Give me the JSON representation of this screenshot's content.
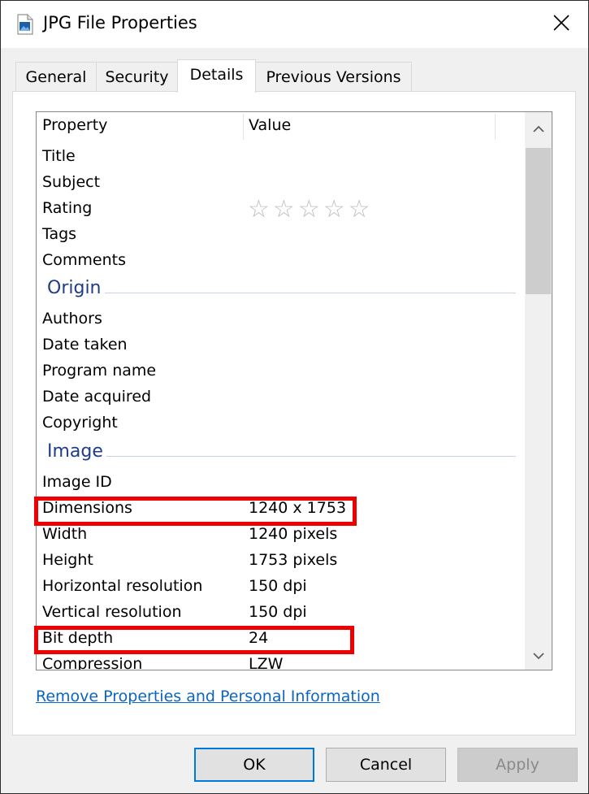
{
  "window": {
    "title": "JPG File Properties"
  },
  "tabs": [
    {
      "label": "General"
    },
    {
      "label": "Security"
    },
    {
      "label": "Details"
    },
    {
      "label": "Previous Versions"
    }
  ],
  "columns": {
    "property": "Property",
    "value": "Value"
  },
  "rows": {
    "title": {
      "name": "Title",
      "value": ""
    },
    "subject": {
      "name": "Subject",
      "value": ""
    },
    "rating": {
      "name": "Rating",
      "stars": 0,
      "max_stars": 5
    },
    "tags": {
      "name": "Tags",
      "value": ""
    },
    "comments": {
      "name": "Comments",
      "value": ""
    },
    "authors": {
      "name": "Authors",
      "value": ""
    },
    "date_taken": {
      "name": "Date taken",
      "value": ""
    },
    "program_name": {
      "name": "Program name",
      "value": ""
    },
    "date_acquired": {
      "name": "Date acquired",
      "value": ""
    },
    "copyright": {
      "name": "Copyright",
      "value": ""
    },
    "image_id": {
      "name": "Image ID",
      "value": ""
    },
    "dimensions": {
      "name": "Dimensions",
      "value": "1240 x 1753"
    },
    "width": {
      "name": "Width",
      "value": "1240 pixels"
    },
    "height": {
      "name": "Height",
      "value": "1753 pixels"
    },
    "hres": {
      "name": "Horizontal resolution",
      "value": "150 dpi"
    },
    "vres": {
      "name": "Vertical resolution",
      "value": "150 dpi"
    },
    "bit_depth": {
      "name": "Bit depth",
      "value": "24"
    },
    "compression": {
      "name": "Compression",
      "value": "LZW"
    }
  },
  "groups": {
    "origin": "Origin",
    "image": "Image"
  },
  "link": {
    "label": "Remove Properties and Personal Information"
  },
  "buttons": {
    "ok": "OK",
    "cancel": "Cancel",
    "apply": "Apply"
  },
  "colors": {
    "highlight": "#ee0000",
    "group_heading": "#1e3d8a",
    "link": "#0a66c2",
    "default_button_border": "#0078d7"
  },
  "icons": {
    "title": "image-file-icon",
    "close": "close-icon",
    "scroll_up": "chevron-up-icon",
    "scroll_down": "chevron-down-icon",
    "star": "star-outline-icon"
  }
}
